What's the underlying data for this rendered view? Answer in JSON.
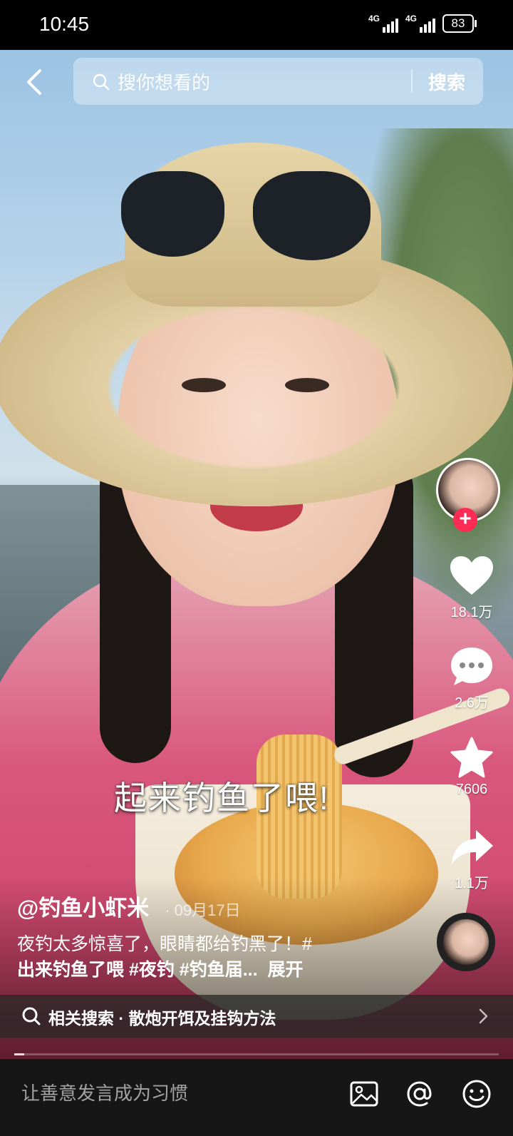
{
  "status_bar": {
    "time": "10:45",
    "network_1": "4G",
    "network_2": "4G",
    "battery": "83"
  },
  "search": {
    "placeholder": "搜你想看的",
    "submit_label": "搜索"
  },
  "video": {
    "subtitle": "起来钓鱼了喂!",
    "progress": 0.02
  },
  "post": {
    "author": "@钓鱼小虾米",
    "date": "· 09月17日",
    "description_line1": "夜钓太多惊喜了，眼睛都给钓黑了！#",
    "description_line2": "出来钓鱼了喂 #夜钓 #钓鱼届...",
    "expand_label": "展开"
  },
  "actions": {
    "likes": "18.1万",
    "comments": "2.6万",
    "favorites": "7606",
    "shares": "1.1万"
  },
  "related": {
    "label": "相关搜索 · 散炮开饵及挂钩方法"
  },
  "comment_bar": {
    "placeholder": "让善意发言成为习惯"
  },
  "colors": {
    "accent": "#fe2c55",
    "bar_bg": "#161616"
  },
  "icons": [
    "back-icon",
    "search-icon",
    "plus-icon",
    "heart-icon",
    "comment-icon",
    "star-icon",
    "share-icon",
    "chevron-right-icon",
    "image-icon",
    "at-icon",
    "emoji-icon"
  ]
}
